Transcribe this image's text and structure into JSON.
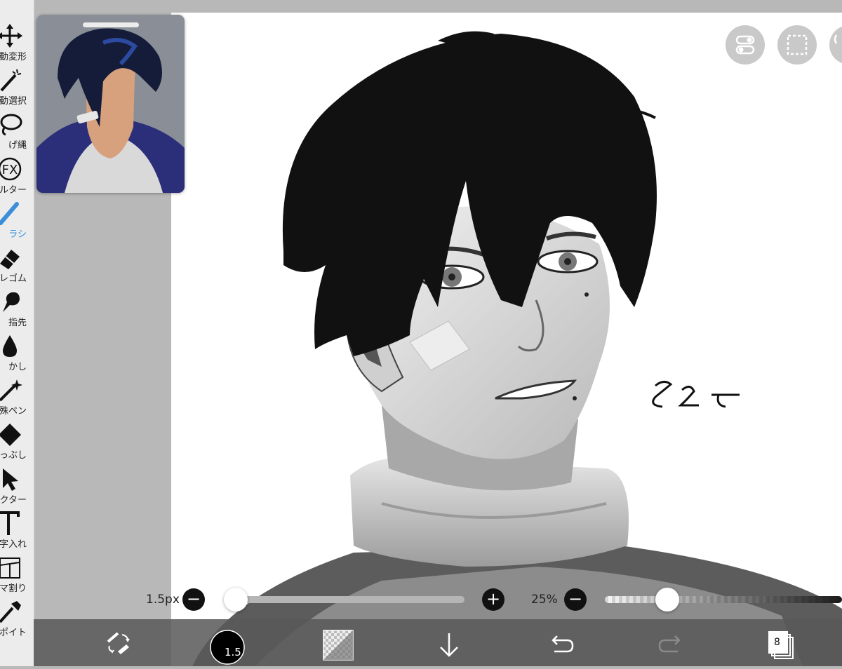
{
  "tools": [
    {
      "id": "transform",
      "label": "動変形",
      "icon": "move-arrows-icon",
      "active": false
    },
    {
      "id": "magic-wand",
      "label": "動選択",
      "icon": "magic-wand-icon",
      "active": false
    },
    {
      "id": "lasso",
      "label": "げ縄",
      "icon": "lasso-icon",
      "active": false
    },
    {
      "id": "filter",
      "label": "ルター",
      "icon": "fx-filter-icon",
      "active": false
    },
    {
      "id": "brush",
      "label": "ラシ",
      "icon": "brush-icon",
      "active": true
    },
    {
      "id": "eraser",
      "label": "レゴム",
      "icon": "eraser-icon",
      "active": false
    },
    {
      "id": "smudge",
      "label": "指先",
      "icon": "finger-smudge-icon",
      "active": false
    },
    {
      "id": "blur",
      "label": "かし",
      "icon": "blur-drop-icon",
      "active": false
    },
    {
      "id": "special-pen",
      "label": "殊ペン",
      "icon": "special-pen-icon",
      "active": false
    },
    {
      "id": "fill",
      "label": "っぶし",
      "icon": "fill-icon",
      "active": false
    },
    {
      "id": "vector",
      "label": "クター",
      "icon": "vector-arrow-icon",
      "active": false
    },
    {
      "id": "text",
      "label": "字入れ",
      "icon": "text-icon",
      "active": false
    },
    {
      "id": "frame",
      "label": "マ割り",
      "icon": "frame-divider-icon",
      "active": false
    },
    {
      "id": "eyedropper",
      "label": "ポイト",
      "icon": "eyedropper-icon",
      "active": false
    }
  ],
  "brush_size": {
    "label": "1.5px",
    "minus": "−",
    "plus": "+",
    "value_fraction": 0.02
  },
  "opacity": {
    "label": "25%",
    "minus": "−",
    "value_fraction": 0.25
  },
  "bottom_bar": {
    "brush_dot_label": "1.5",
    "layers_count": "8"
  },
  "colors": {
    "accent": "#3a8fd8",
    "toolbar_bg": "#ececec",
    "workspace_bg": "#b8b8b8"
  }
}
